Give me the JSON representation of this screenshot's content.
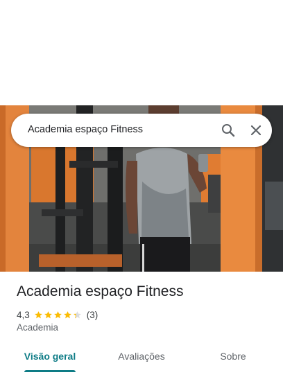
{
  "search": {
    "query": "Academia espaço Fitness"
  },
  "place": {
    "title": "Academia espaço Fitness",
    "rating": "4,3",
    "stars": 4.3,
    "review_count": "(3)",
    "category": "Academia"
  },
  "tabs": [
    {
      "label": "Visão geral",
      "active": true
    },
    {
      "label": "Avaliações",
      "active": false
    },
    {
      "label": "Sobre",
      "active": false
    }
  ],
  "colors": {
    "accent": "#0e7c86",
    "star": "#fbbc04",
    "star_empty": "#dadce0"
  },
  "icons": {
    "search": "search-icon",
    "close": "close-icon",
    "star": "star-icon"
  }
}
